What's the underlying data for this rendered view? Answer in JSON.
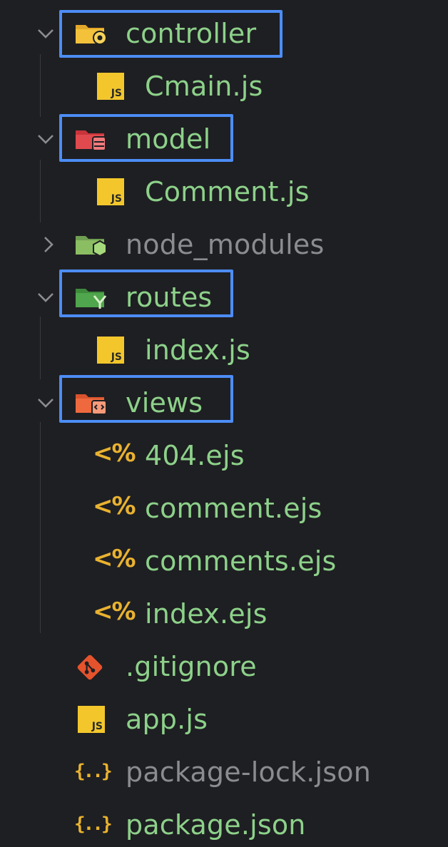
{
  "tree": {
    "items": [
      {
        "label": "controller",
        "kind": "folder",
        "expanded": true,
        "icon": "folder-controller-icon",
        "color": "#8dd18a",
        "highlighted": true
      },
      {
        "label": "Cmain.js",
        "kind": "file",
        "icon": "js-file-icon",
        "color": "#8dd18a"
      },
      {
        "label": "model",
        "kind": "folder",
        "expanded": true,
        "icon": "folder-model-icon",
        "color": "#8dd18a",
        "highlighted": true
      },
      {
        "label": "Comment.js",
        "kind": "file",
        "icon": "js-file-icon",
        "color": "#8dd18a"
      },
      {
        "label": "node_modules",
        "kind": "folder",
        "expanded": false,
        "icon": "folder-node-icon",
        "color": "#8b8c90"
      },
      {
        "label": "routes",
        "kind": "folder",
        "expanded": true,
        "icon": "folder-routes-icon",
        "color": "#8dd18a",
        "highlighted": true
      },
      {
        "label": "index.js",
        "kind": "file",
        "icon": "js-file-icon",
        "color": "#8dd18a"
      },
      {
        "label": "views",
        "kind": "folder",
        "expanded": true,
        "icon": "folder-views-icon",
        "color": "#8dd18a",
        "highlighted": true
      },
      {
        "label": "404.ejs",
        "kind": "file",
        "icon": "ejs-file-icon",
        "color": "#8dd18a"
      },
      {
        "label": "comment.ejs",
        "kind": "file",
        "icon": "ejs-file-icon",
        "color": "#8dd18a"
      },
      {
        "label": "comments.ejs",
        "kind": "file",
        "icon": "ejs-file-icon",
        "color": "#8dd18a"
      },
      {
        "label": "index.ejs",
        "kind": "file",
        "icon": "ejs-file-icon",
        "color": "#8dd18a"
      },
      {
        "label": ".gitignore",
        "kind": "file",
        "icon": "git-icon",
        "color": "#8dd18a"
      },
      {
        "label": "app.js",
        "kind": "file",
        "icon": "js-file-icon",
        "color": "#8dd18a"
      },
      {
        "label": "package-lock.json",
        "kind": "file",
        "icon": "json-file-icon",
        "color": "#8b8c90"
      },
      {
        "label": "package.json",
        "kind": "file",
        "icon": "json-file-icon",
        "color": "#8dd18a"
      }
    ],
    "js_badge_text": "JS",
    "ejs_glyph": "<%",
    "json_glyph": "{..}",
    "highlight_color": "#4d8df5"
  }
}
